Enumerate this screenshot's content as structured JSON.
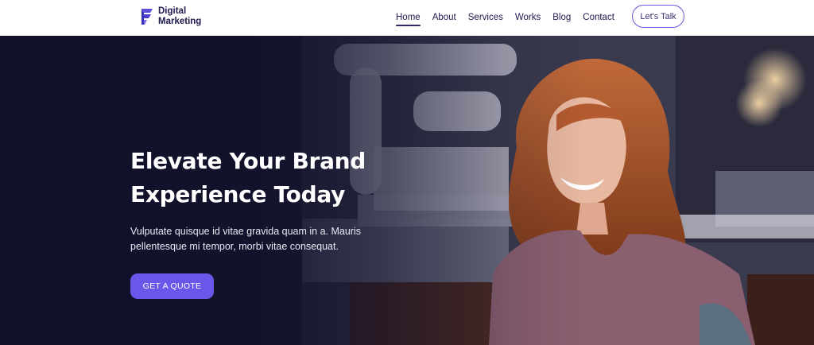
{
  "brand": {
    "line1": "Digital",
    "line2": "Marketing",
    "accent_color": "#5b4fe0"
  },
  "nav": {
    "items": [
      {
        "label": "Home",
        "active": true
      },
      {
        "label": "About"
      },
      {
        "label": "Services"
      },
      {
        "label": "Works"
      },
      {
        "label": "Blog"
      },
      {
        "label": "Contact"
      }
    ],
    "cta_label": "Let's Talk"
  },
  "hero": {
    "title_line1": "Elevate Your Brand",
    "title_line2": "Experience Today",
    "description_line1": "Vulputate quisque id vitae gravida quam in a. Mauris",
    "description_line2": "pellentesque mi tempor, morbi vitae consequat.",
    "button_label": "GET A QUOTE",
    "button_color": "#6a56e8",
    "overlay_color": "#10102a"
  }
}
